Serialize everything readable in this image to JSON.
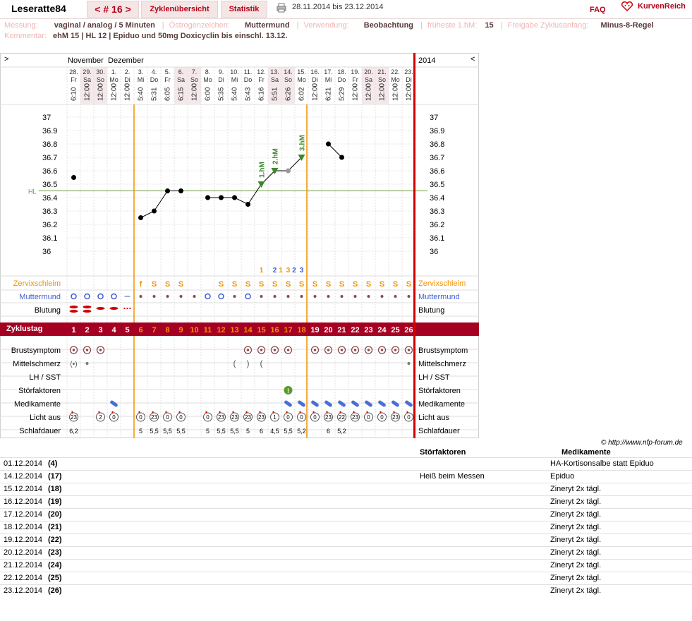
{
  "header": {
    "username": "Leseratte84",
    "cycle_prev": "<",
    "cycle_label": "# 16",
    "cycle_next": ">",
    "tab_overview": "Zyklenübersicht",
    "tab_stats": "Statistik",
    "date_range": "28.11.2014 bis 23.12.2014",
    "faq": "FAQ",
    "logo": "KurvenReich"
  },
  "info": {
    "measure_label": "Messung:",
    "measure_value": "vaginal / analog / 5 Minuten",
    "estrogen_label": "Östrogenzeichen:",
    "estrogen_value": "Muttermund",
    "usage_label": "Verwendung:",
    "usage_value": "Beobachtung",
    "earliest_label": "früheste 1.hM:",
    "earliest_value": "15",
    "release_label": "Freigabe Zyklusanfang:",
    "release_value": "Minus-8-Regel",
    "comment_label": "Kommentar:",
    "comment_value": "ehM 15 | HL 12 | Epiduo und 50mg Doxicyclin bis einschl. 13.12."
  },
  "chart_data": {
    "type": "line",
    "nav_left": ">",
    "nav_right": "<",
    "year": "2014",
    "months": [
      "November",
      "Dezember"
    ],
    "dates": [
      "28.",
      "29.",
      "30.",
      "1.",
      "2.",
      "3.",
      "4.",
      "5.",
      "6.",
      "7.",
      "8.",
      "9.",
      "10.",
      "11.",
      "12.",
      "13.",
      "14.",
      "15.",
      "16.",
      "17.",
      "18.",
      "19.",
      "20.",
      "21.",
      "22.",
      "23."
    ],
    "weekdays": [
      "Fr",
      "Sa",
      "So",
      "Mo",
      "Di",
      "Mi",
      "Do",
      "Fr",
      "Sa",
      "So",
      "Mo",
      "Di",
      "Mi",
      "Do",
      "Fr",
      "Sa",
      "So",
      "Mo",
      "Di",
      "Mi",
      "Do",
      "Fr",
      "Sa",
      "So",
      "Mo",
      "Di"
    ],
    "times": [
      "6:10",
      "12:00",
      "12:00",
      "12:00",
      "12:00",
      "5:40",
      "5:31",
      "6:05",
      "6:15",
      "12:00",
      "6:00",
      "5:35",
      "5:40",
      "5:43",
      "6:16",
      "5:51",
      "6:26",
      "6:02",
      "12:00",
      "6:21",
      "5:29",
      "12:00",
      "12:00",
      "12:00",
      "12:00",
      "12:00"
    ],
    "y_ticks": [
      "37",
      "36.9",
      "36.8",
      "36.7",
      "36.6",
      "36.5",
      "36.4",
      "36.3",
      "36.2",
      "36.1",
      "36"
    ],
    "ylim": [
      36.0,
      37.0
    ],
    "hl_label": "HL",
    "hl_value": 36.45,
    "temps": [
      36.55,
      null,
      null,
      null,
      null,
      36.25,
      36.3,
      36.45,
      36.45,
      null,
      36.4,
      36.4,
      36.4,
      36.35,
      36.5,
      36.6,
      36.6,
      36.7,
      null,
      36.8,
      36.7,
      null,
      null,
      null,
      null,
      null
    ],
    "markers": [
      {
        "label": "1.hM",
        "day": 15
      },
      {
        "label": "2.hM",
        "day": 16
      },
      {
        "label": "3.hM",
        "day": 18
      }
    ],
    "count_labels": [
      "1",
      "2",
      "1",
      "3",
      "2",
      "3"
    ],
    "cycle_days": [
      "1",
      "2",
      "3",
      "4",
      "5",
      "6",
      "7",
      "8",
      "9",
      "10",
      "11",
      "12",
      "13",
      "14",
      "15",
      "16",
      "17",
      "18",
      "19",
      "20",
      "21",
      "22",
      "23",
      "24",
      "25",
      "26"
    ],
    "rows": {
      "zervix": "Zervixschleim",
      "muttermund": "Muttermund",
      "blutung": "Blutung",
      "zyklustag": "Zyklustag",
      "brust": "Brustsymptom",
      "mittel": "Mittelschmerz",
      "lh": "LH / SST",
      "stoer": "Störfaktoren",
      "medi": "Medikamente",
      "licht": "Licht aus",
      "schlaf": "Schlafdauer"
    },
    "zervix_symbols": [
      "",
      "",
      "",
      "",
      "",
      "f",
      "S",
      "S",
      "S",
      "",
      "",
      "S",
      "S",
      "S",
      "S",
      "S",
      "S",
      "S",
      "S",
      "S",
      "S",
      "S",
      "S",
      "S",
      "S",
      "S"
    ],
    "licht_values": [
      "23",
      "",
      "2",
      "0",
      "",
      "0",
      "23",
      "0",
      "0",
      "",
      "0",
      "23",
      "23",
      "23",
      "23",
      "1",
      "0",
      "0",
      "0",
      "23",
      "22",
      "23",
      "0",
      "0",
      "23",
      "0"
    ],
    "schlaf_values": [
      "6,2",
      "",
      "",
      "",
      "",
      "5",
      "5,5",
      "5,5",
      "5,5",
      "",
      "5",
      "5,5",
      "5,5",
      "5",
      "6",
      "4,5",
      "5,5",
      "5,2",
      "",
      "6",
      "5,2",
      "",
      "",
      "",
      "",
      ""
    ]
  },
  "footer": {
    "copyright": "© http://www.nfp-forum.de",
    "col_stoer": "Störfaktoren",
    "col_medi": "Medikamente",
    "rows": [
      {
        "date": "01.12.2014",
        "num": "(4)",
        "stoer": "",
        "medi": "HA-Kortisonsalbe statt Epiduo"
      },
      {
        "date": "14.12.2014",
        "num": "(17)",
        "stoer": "Heiß beim Messen",
        "medi": "Epiduo"
      },
      {
        "date": "15.12.2014",
        "num": "(18)",
        "stoer": "",
        "medi": "Zineryt 2x tägl."
      },
      {
        "date": "16.12.2014",
        "num": "(19)",
        "stoer": "",
        "medi": "Zineryt 2x tägl."
      },
      {
        "date": "17.12.2014",
        "num": "(20)",
        "stoer": "",
        "medi": "Zineryt 2x tägl."
      },
      {
        "date": "18.12.2014",
        "num": "(21)",
        "stoer": "",
        "medi": "Zineryt 2x tägl."
      },
      {
        "date": "19.12.2014",
        "num": "(22)",
        "stoer": "",
        "medi": "Zineryt 2x tägl."
      },
      {
        "date": "20.12.2014",
        "num": "(23)",
        "stoer": "",
        "medi": "Zineryt 2x tägl."
      },
      {
        "date": "21.12.2014",
        "num": "(24)",
        "stoer": "",
        "medi": "Zineryt 2x tägl."
      },
      {
        "date": "22.12.2014",
        "num": "(25)",
        "stoer": "",
        "medi": "Zineryt 2x tägl."
      },
      {
        "date": "23.12.2014",
        "num": "(26)",
        "stoer": "",
        "medi": "Zineryt 2x tägl."
      }
    ]
  }
}
